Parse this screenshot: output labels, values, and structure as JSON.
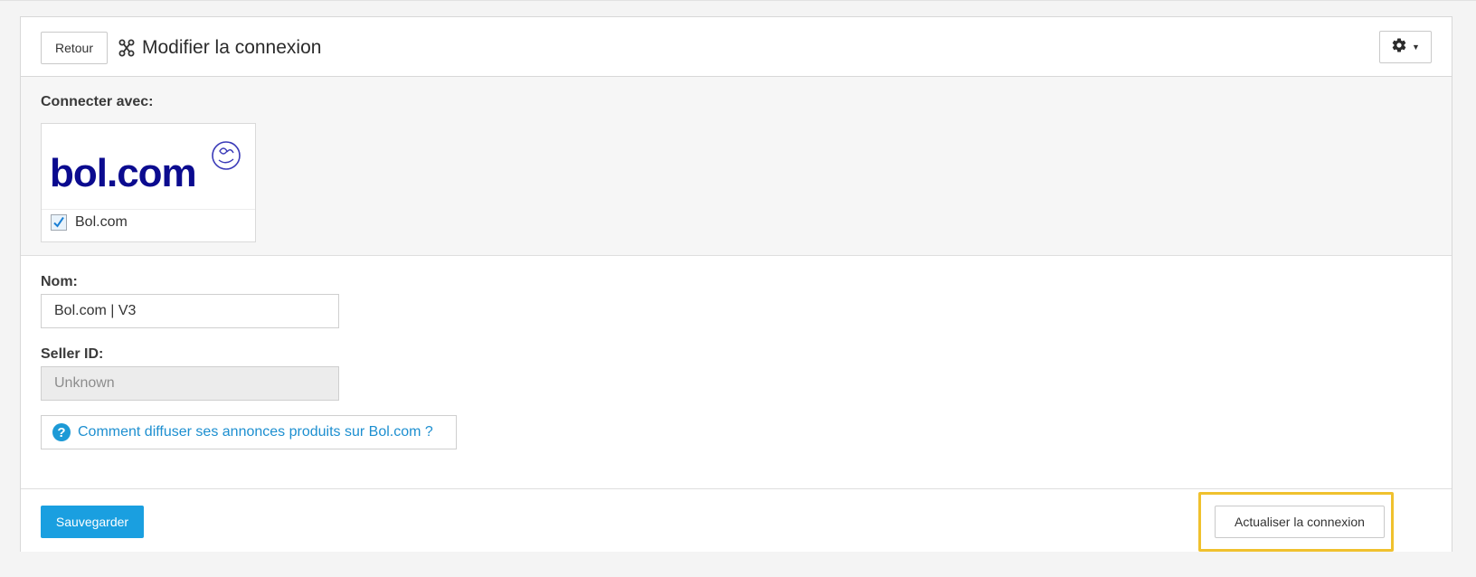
{
  "header": {
    "back_label": "Retour",
    "title": "Modifier la connexion",
    "title_icon": "connection-icon",
    "settings_icon": "gear-icon"
  },
  "connect": {
    "label": "Connecter avec:",
    "provider": {
      "logo_text": "bol.com",
      "name": "Bol.com",
      "checked": true,
      "logo_color": "#0b0b8f"
    }
  },
  "form": {
    "name_label": "Nom:",
    "name_value": "Bol.com | V3",
    "seller_label": "Seller ID:",
    "seller_value": "Unknown",
    "help_text": "Comment diffuser ses annonces produits sur Bol.com ?",
    "help_icon": "question-circle-icon"
  },
  "footer": {
    "save_label": "Sauvegarder",
    "refresh_label": "Actualiser la connexion"
  },
  "colors": {
    "primary": "#1a9fe0",
    "link": "#1d8fd0",
    "highlight": "#f0c12e"
  }
}
